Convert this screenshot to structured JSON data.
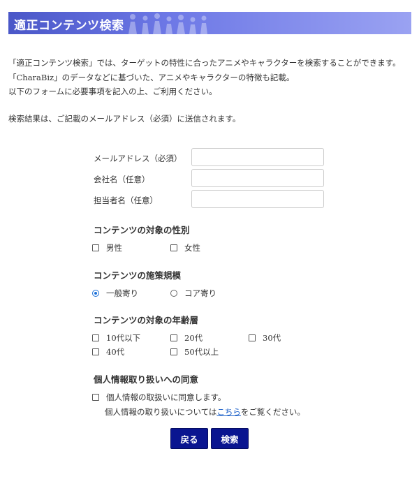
{
  "header": {
    "title": "適正コンテンツ検索"
  },
  "intro": {
    "line1": "「適正コンテンツ検索」では、ターゲットの特性に合ったアニメやキャラクターを検索することができます。",
    "line2": "「CharaBiz」のデータなどに基づいた、アニメやキャラクターの特徴も記載。",
    "line3": "以下のフォームに必要事項を記入の上、ご利用ください。"
  },
  "notice": "検索結果は、ご記載のメールアドレス（必須）に送信されます。",
  "form": {
    "email_label": "メールアドレス（必須）",
    "email_value": "",
    "company_label": "会社名（任意）",
    "company_value": "",
    "person_label": "担当者名（任意）",
    "person_value": ""
  },
  "gender": {
    "title": "コンテンツの対象の性別",
    "options": [
      {
        "label": "男性",
        "checked": false
      },
      {
        "label": "女性",
        "checked": false
      }
    ]
  },
  "scale": {
    "title": "コンテンツの施策規模",
    "options": [
      {
        "label": "一般寄り",
        "selected": true
      },
      {
        "label": "コア寄り",
        "selected": false
      }
    ]
  },
  "age": {
    "title": "コンテンツの対象の年齢層",
    "options": [
      {
        "label": "10代以下",
        "checked": false
      },
      {
        "label": "20代",
        "checked": false
      },
      {
        "label": "30代",
        "checked": false
      },
      {
        "label": "40代",
        "checked": false
      },
      {
        "label": "50代以上",
        "checked": false
      }
    ]
  },
  "privacy": {
    "title": "個人情報取り扱いへの同意",
    "agree_label": "個人情報の取扱いに同意します。",
    "agree_checked": false,
    "note_prefix": "個人情報の取り扱いについては",
    "link_text": "こちら",
    "note_suffix": "をご覧ください。"
  },
  "buttons": {
    "back": "戻る",
    "search": "検索"
  },
  "colors": {
    "header_start": "#4a57c8",
    "header_end": "#9aa2f2",
    "button": "#0a1590",
    "radio_accent": "#1a6fd8",
    "link": "#1a5fc8"
  },
  "icons": {
    "header_decoration": "people-silhouette-icon"
  }
}
